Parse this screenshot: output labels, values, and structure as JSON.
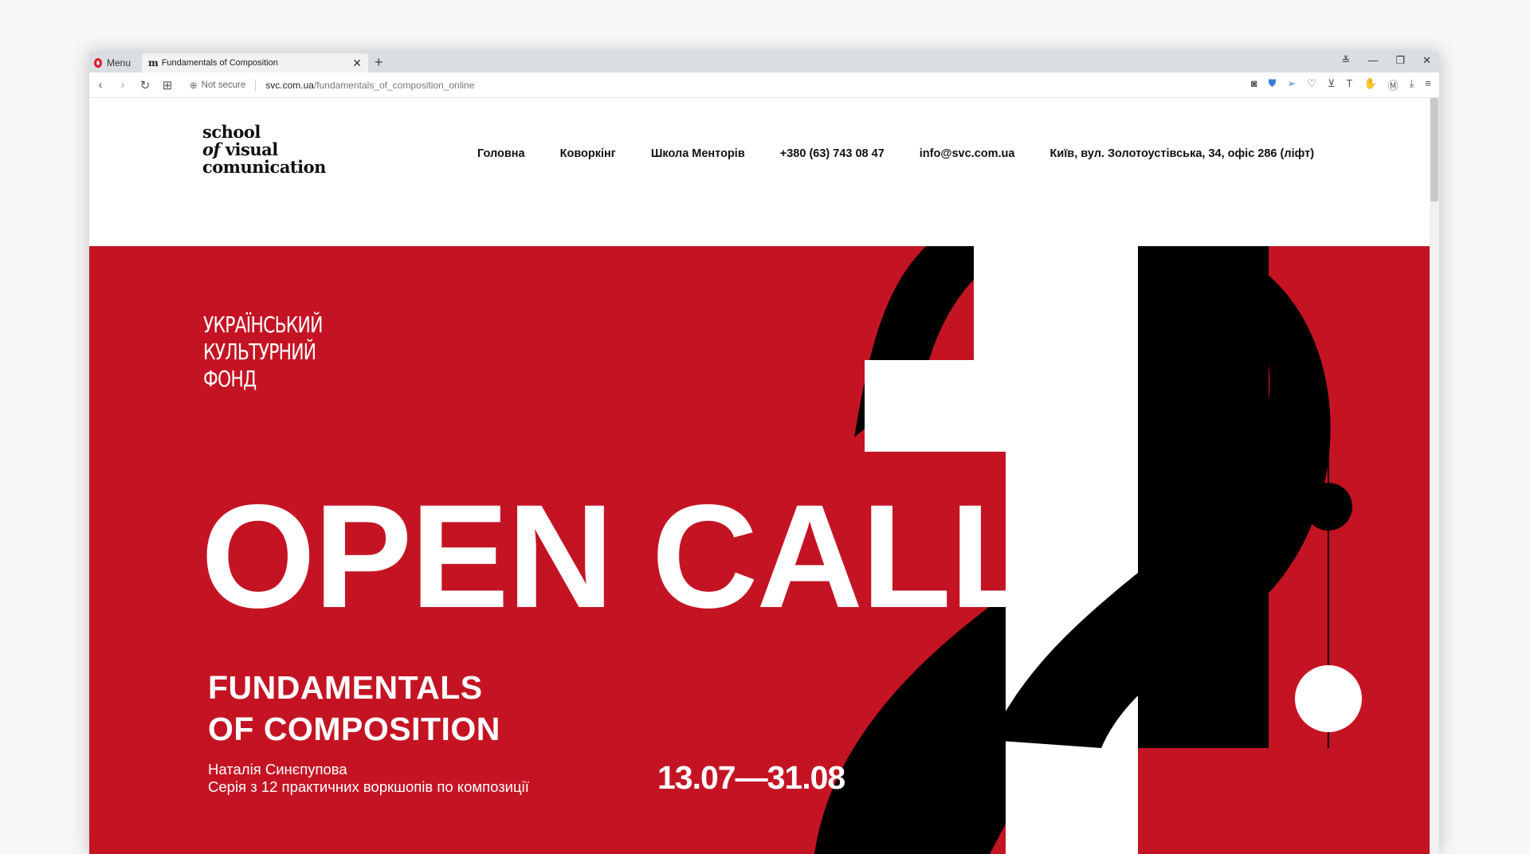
{
  "browser": {
    "menu_label": "Menu",
    "tab_title": "Fundamentals of Composition",
    "security_label": "Not secure",
    "url_domain": "svc.com.ua",
    "url_path": "/fundamentals_of_composition_online"
  },
  "site": {
    "logo": {
      "line1": "school",
      "line2_italic": "of",
      "line2_rest": " visual",
      "line3": "comunication"
    },
    "nav": [
      "Головна",
      "Коворкінг",
      "Школа Менторів",
      "+380 (63) 743 08 47",
      "info@svc.com.ua",
      "Київ, вул. Золотоустівська, 34, офіс 286 (ліфт)"
    ]
  },
  "hero": {
    "partner_logo": [
      "Український",
      "культурний",
      "фонд"
    ],
    "headline": "OPEN CALL",
    "course_title_line1": "FUNDAMENTALS",
    "course_title_line2": "OF COMPOSITION",
    "author": "Наталія Синєпупова",
    "subtitle": "Серія з 12 практичних воркшопів по композиції",
    "dates": "13.07—31.08"
  },
  "colors": {
    "hero_red": "#c41424",
    "black": "#000000",
    "white": "#ffffff"
  }
}
